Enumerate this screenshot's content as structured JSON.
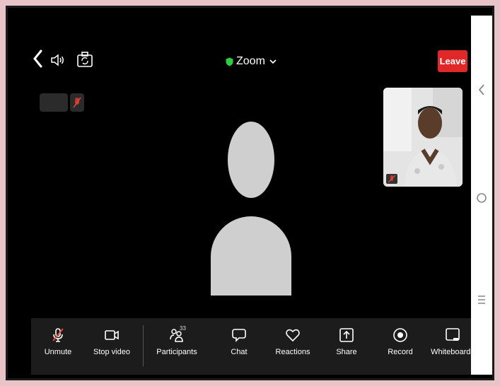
{
  "header": {
    "title": "Zoom",
    "leave_label": "Leave"
  },
  "toolbar": {
    "items": [
      {
        "label": "Unmute",
        "icon": "mic-muted-icon"
      },
      {
        "label": "Stop video",
        "icon": "video-camera-icon"
      },
      {
        "label": "Participants",
        "icon": "participants-icon",
        "count": "33"
      },
      {
        "label": "Chat",
        "icon": "chat-icon"
      },
      {
        "label": "Reactions",
        "icon": "heart-icon"
      },
      {
        "label": "Share",
        "icon": "share-icon"
      },
      {
        "label": "Record",
        "icon": "record-icon"
      },
      {
        "label": "Whiteboards",
        "icon": "whiteboard-icon"
      }
    ]
  },
  "colors": {
    "leave": "#e02828",
    "background": "#000000",
    "toolbar": "#1c1c1c",
    "avatar": "#cfcfcf",
    "shield": "#2ecc40"
  }
}
